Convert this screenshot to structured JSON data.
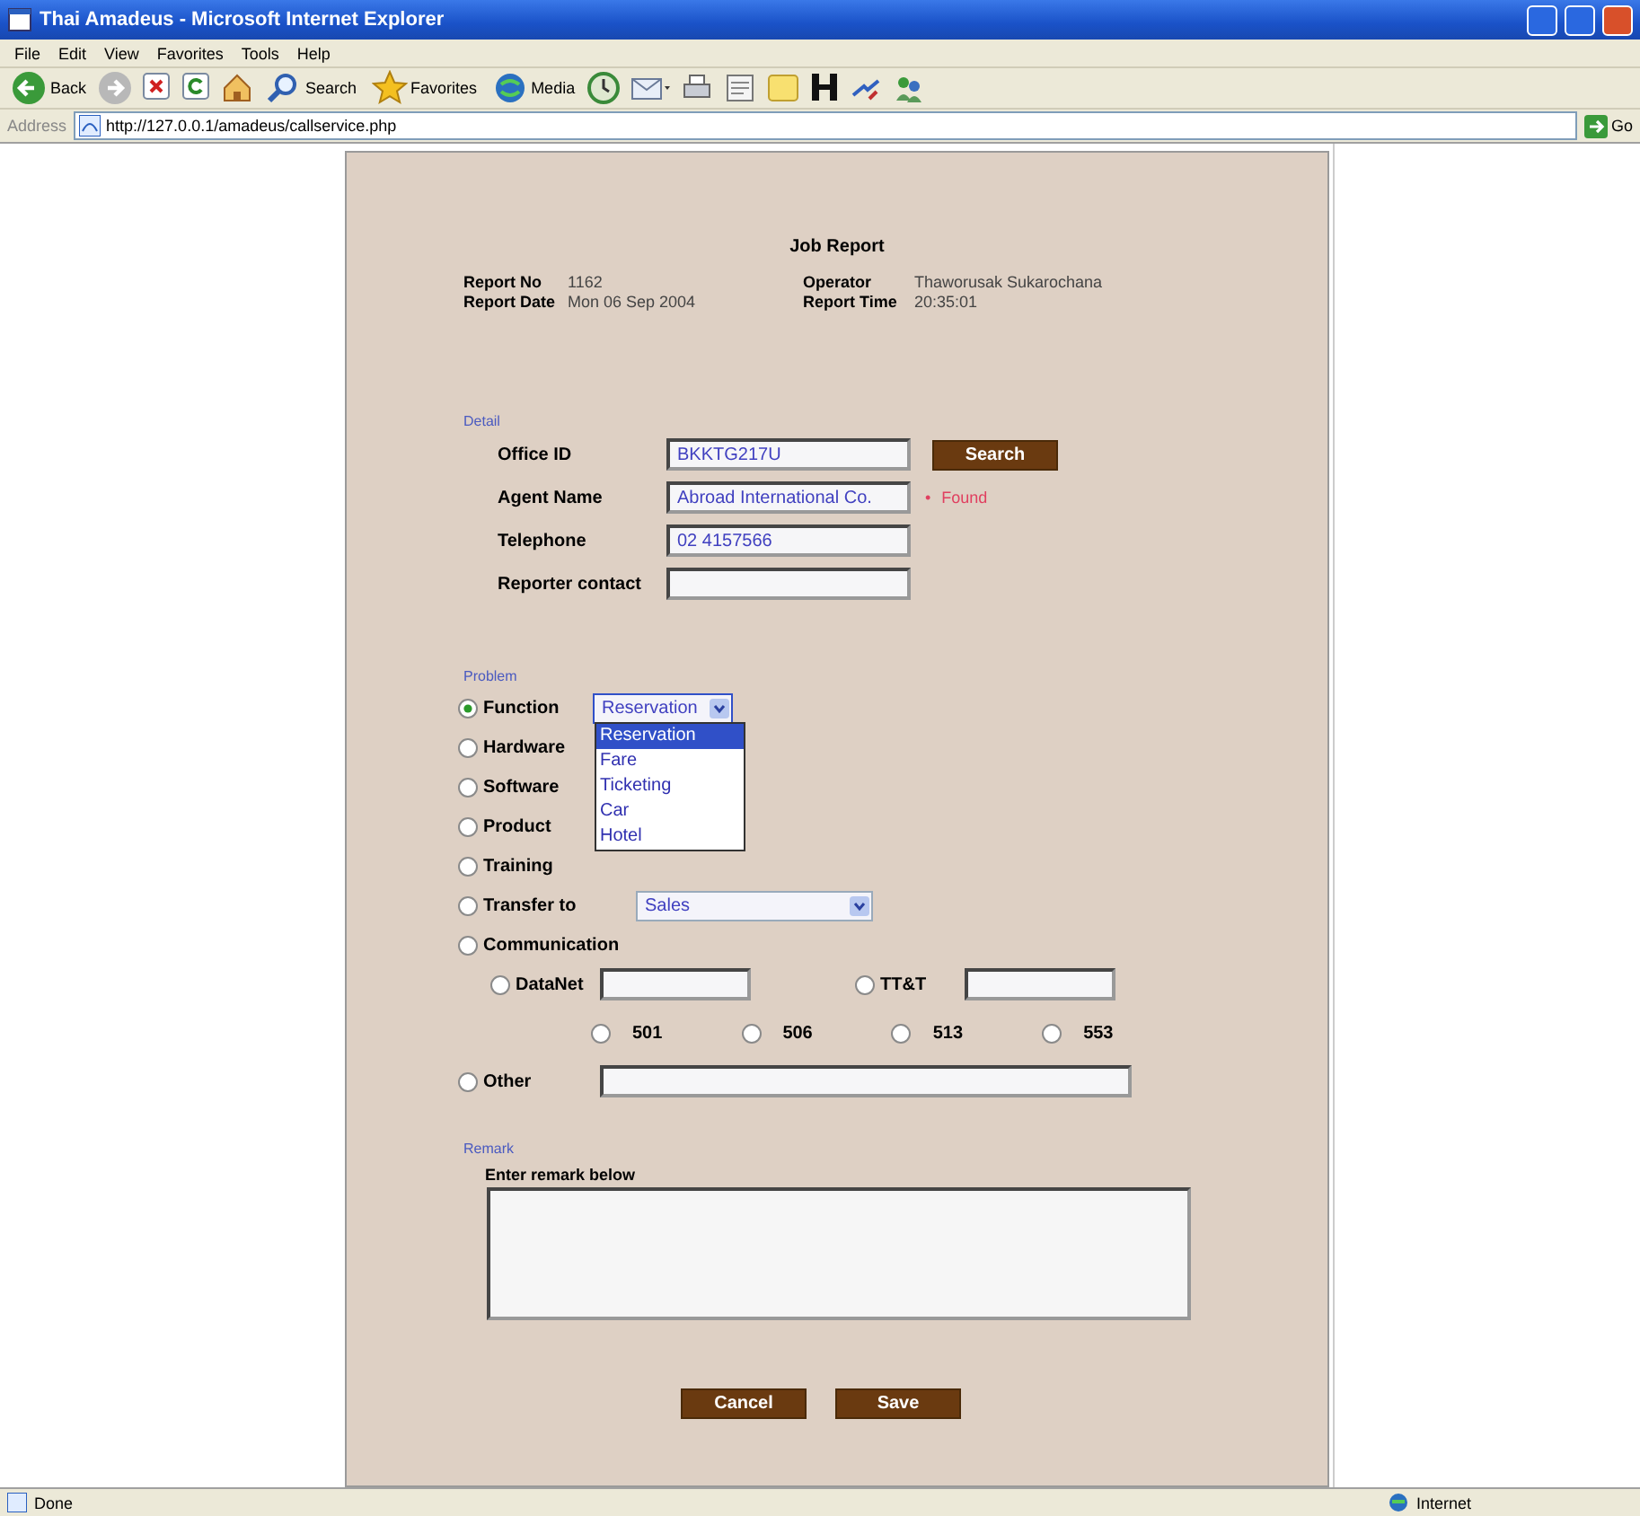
{
  "window": {
    "title": "Thai Amadeus - Microsoft Internet Explorer"
  },
  "menu": [
    "File",
    "Edit",
    "View",
    "Favorites",
    "Tools",
    "Help"
  ],
  "toolbar": [
    {
      "kind": "back",
      "label": "Back"
    },
    {
      "kind": "forward"
    },
    {
      "kind": "stop"
    },
    {
      "kind": "refresh"
    },
    {
      "kind": "home"
    },
    {
      "kind": "search",
      "label": "Search"
    },
    {
      "kind": "favorites",
      "label": "Favorites"
    },
    {
      "kind": "media",
      "label": "Media"
    },
    {
      "kind": "history"
    },
    {
      "kind": "mail"
    },
    {
      "kind": "print"
    },
    {
      "kind": "edit"
    },
    {
      "kind": "note"
    },
    {
      "kind": "letter"
    },
    {
      "kind": "messenger"
    },
    {
      "kind": "people"
    }
  ],
  "address_bar": {
    "label": "Address",
    "url": "http://127.0.0.1/amadeus/callservice.php",
    "go": "Go"
  },
  "form": {
    "title": "Job Report",
    "header": [
      {
        "label": "Report No",
        "value": "1162"
      },
      {
        "label": "Operator",
        "value": "Thaworusak Sukarochana"
      },
      {
        "label": "Report Date",
        "value": "Mon 06 Sep 2004"
      },
      {
        "label": "Report Time",
        "value": "20:35:01"
      }
    ],
    "detail": {
      "legend": "Detail",
      "fields": [
        {
          "label": "Office ID",
          "value": "BKKTG217U"
        },
        {
          "label": "Agent Name",
          "value": "Abroad International Co."
        },
        {
          "label": "Telephone",
          "value": "02 4157566"
        },
        {
          "label": "Reporter contact"
        }
      ],
      "search_button": "Search",
      "bullet": "•",
      "status": "Found"
    },
    "problem": {
      "legend": "Problem",
      "options": [
        {
          "kind": "select",
          "label": "Function",
          "selected": true,
          "value": "Reservation",
          "expanded": true,
          "list": [
            {
              "label": "Reservation",
              "selected": true
            },
            {
              "label": "Fare",
              "selected": false
            },
            {
              "label": "Ticketing",
              "selected": false
            },
            {
              "label": "Car",
              "selected": false
            },
            {
              "label": "Hotel",
              "selected": false
            }
          ]
        },
        {
          "kind": "plain",
          "label": "Hardware",
          "selected": false
        },
        {
          "kind": "plain",
          "label": "Software",
          "selected": false
        },
        {
          "kind": "plain",
          "label": "Product",
          "selected": false
        },
        {
          "kind": "plain",
          "label": "Training",
          "selected": false
        },
        {
          "kind": "select",
          "label": "Transfer to",
          "selected": false,
          "value": "Sales",
          "expanded": false
        },
        {
          "kind": "plain",
          "label": "Communication",
          "selected": false
        }
      ],
      "channels": [
        {
          "label": "DataNet",
          "selected": false
        },
        {
          "label": "TT&T",
          "selected": false
        }
      ],
      "codes": [
        {
          "label": "501",
          "selected": false
        },
        {
          "label": "506",
          "selected": false
        },
        {
          "label": "513",
          "selected": false
        },
        {
          "label": "553",
          "selected": false
        }
      ],
      "other": {
        "label": "Other",
        "selected": false
      }
    },
    "remark": {
      "legend": "Remark",
      "label": "Enter remark below"
    },
    "buttons": [
      "Cancel",
      "Save"
    ]
  },
  "status_bar": {
    "text": "Done",
    "zone": "Internet"
  }
}
